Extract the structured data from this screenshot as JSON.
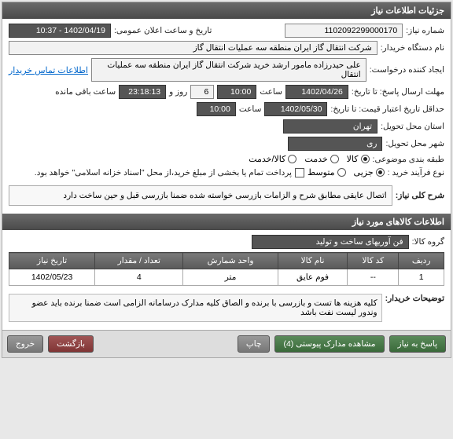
{
  "header": {
    "title": "جزئیات اطلاعات نیاز"
  },
  "fields": {
    "need_no_label": "شماره نیاز:",
    "need_no": "1102092299000170",
    "announce_label": "تاریخ و ساعت اعلان عمومی:",
    "announce": "1402/04/19 - 10:37",
    "buyer_label": "نام دستگاه خریدار:",
    "buyer": "شرکت انتقال گاز ایران منطقه سه عملیات انتقال گاز",
    "creator_label": "ایجاد کننده درخواست:",
    "creator": "علی حیدرزاده مامور ارشد خرید شرکت انتقال گاز ایران منطقه سه عملیات انتقال",
    "contact_link": "اطلاعات تماس خریدار",
    "deadline_label": "مهلت ارسال پاسخ: تا تاریخ:",
    "deadline_date": "1402/04/26",
    "time_label": "ساعت",
    "deadline_time": "10:00",
    "days_label": "روز و",
    "days": "6",
    "remain_time": "23:18:13",
    "remain_suffix": "ساعت باقی مانده",
    "valid_label": "حداقل تاریخ اعتبار قیمت: تا تاریخ:",
    "valid_date": "1402/05/30",
    "valid_time": "10:00",
    "loc_label": "استان محل تحویل:",
    "loc": "تهران",
    "city_label": "شهر محل تحویل:",
    "city": "ری",
    "cat_label": "طبقه بندی موضوعی:",
    "cat_opts": {
      "goods": "کالا",
      "service": "خدمت",
      "goods_service": "کالا/خدمت"
    },
    "process_label": "نوع فرآیند خرید :",
    "process_opts": {
      "low": "متوسط",
      "partial": "جزیی"
    },
    "payment_note": "پرداخت تمام یا بخشی از مبلغ خرید،از محل \"اسناد خزانه اسلامی\" خواهد بود."
  },
  "desc": {
    "title_label": "شرح کلی نیاز:",
    "title_text": "اتصال عایقی مطابق شرح و الزامات بازرسی خواسته شده ضمنا بازرسی قبل و حین ساخت دارد"
  },
  "goods": {
    "header": "اطلاعات کالاهای مورد نیاز",
    "group_label": "گروه کالا:",
    "group": "فن آوریهای ساخت و تولید",
    "cols": {
      "row": "ردیف",
      "code": "کد کالا",
      "name": "نام کالا",
      "unit": "واحد شمارش",
      "qty": "تعداد / مقدار",
      "date": "تاریخ نیاز"
    },
    "rows": [
      {
        "row": "1",
        "code": "--",
        "name": "فوم عایق",
        "unit": "متر",
        "qty": "4",
        "date": "1402/05/23"
      }
    ],
    "buyer_note_label": "توضیحات خریدار:",
    "buyer_note": "کلیه هزینه ها تست و بازرسی با برنده و الصاق کلیه مدارک درسامانه الزامی است ضمنا برنده باید عضو وندور لیست نفت باشد"
  },
  "buttons": {
    "respond": "پاسخ به نیاز",
    "attach": "مشاهده مدارک پیوستی (4)",
    "print": "چاپ",
    "back": "بازگشت",
    "exit": "خروج"
  }
}
